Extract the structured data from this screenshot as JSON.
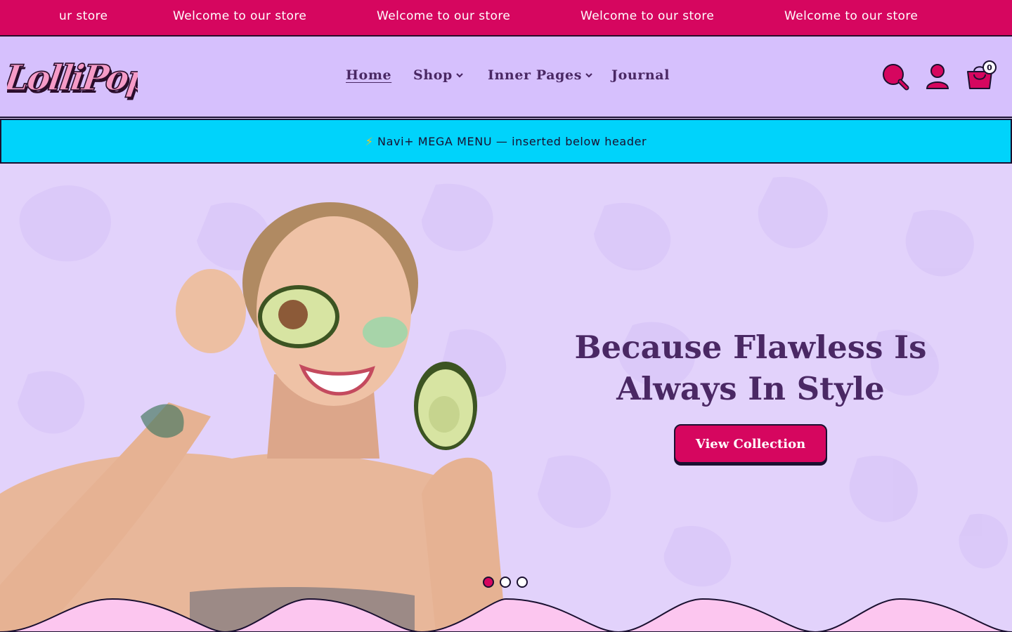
{
  "announcement": {
    "items": [
      "ur store",
      "Welcome to our store",
      "Welcome to our store",
      "Welcome to our store",
      "Welcome to our store"
    ]
  },
  "header": {
    "logo_text": "LolliPop",
    "nav": [
      {
        "label": "Home",
        "active": true,
        "dropdown": false
      },
      {
        "label": "Shop",
        "active": false,
        "dropdown": true
      },
      {
        "label": "Inner Pages",
        "active": false,
        "dropdown": true
      },
      {
        "label": "Journal",
        "active": false,
        "dropdown": false
      }
    ],
    "icons": [
      "search-icon",
      "user-icon",
      "cart-icon"
    ],
    "cart_count": "0"
  },
  "mega_menu": {
    "icon": "lightning-icon",
    "text": "Navi+ MEGA MENU — inserted below header"
  },
  "hero": {
    "title": "Because Flawless Is Always In Style",
    "button_label": "View Collection",
    "slides": 3,
    "active_slide": 1
  },
  "colors": {
    "accent": "#d6065f",
    "header_bg": "#d6c0fd",
    "mega_bg": "#00d3fb",
    "text_dark": "#4a2864",
    "hero_bg": "#e2d2fb",
    "wave": "#fcc6ef"
  }
}
